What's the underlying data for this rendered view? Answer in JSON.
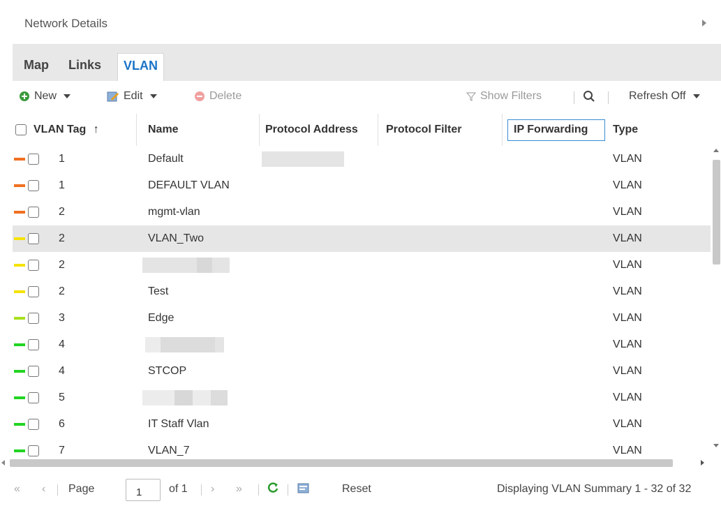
{
  "panel": {
    "title": "Network Details"
  },
  "tabs": [
    {
      "label": "Map",
      "active": false
    },
    {
      "label": "Links",
      "active": false
    },
    {
      "label": "VLAN",
      "active": true
    }
  ],
  "toolbar": {
    "new_label": "New",
    "edit_label": "Edit",
    "delete_label": "Delete",
    "show_filters_label": "Show Filters",
    "refresh_label": "Refresh Off"
  },
  "columns": {
    "vlan_tag": "VLAN Tag",
    "name": "Name",
    "protocol_address": "Protocol Address",
    "protocol_filter": "Protocol Filter",
    "ip_forwarding": "IP Forwarding",
    "type": "Type"
  },
  "sort_indicator": "↑",
  "status_colors": {
    "orange": "#f07020",
    "yellow": "#f5e20a",
    "lime": "#a8e020",
    "green": "#22d422"
  },
  "rows": [
    {
      "tag": "1",
      "name": "Default",
      "type": "VLAN",
      "status": "orange"
    },
    {
      "tag": "1",
      "name": "DEFAULT VLAN",
      "type": "VLAN",
      "status": "orange"
    },
    {
      "tag": "2",
      "name": "mgmt-vlan",
      "type": "VLAN",
      "status": "orange"
    },
    {
      "tag": "2",
      "name": "VLAN_Two",
      "type": "VLAN",
      "status": "yellow"
    },
    {
      "tag": "2",
      "name": "",
      "type": "VLAN",
      "status": "yellow"
    },
    {
      "tag": "2",
      "name": "Test",
      "type": "VLAN",
      "status": "yellow"
    },
    {
      "tag": "3",
      "name": "Edge",
      "type": "VLAN",
      "status": "lime"
    },
    {
      "tag": "4",
      "name": "",
      "type": "VLAN",
      "status": "green"
    },
    {
      "tag": "4",
      "name": "STCOP",
      "type": "VLAN",
      "status": "green"
    },
    {
      "tag": "5",
      "name": "",
      "type": "VLAN",
      "status": "green"
    },
    {
      "tag": "6",
      "name": "IT Staff Vlan",
      "type": "VLAN",
      "status": "green"
    },
    {
      "tag": "7",
      "name": "VLAN_7",
      "type": "VLAN",
      "status": "green"
    }
  ],
  "pager": {
    "page_label": "Page",
    "page_value": "1",
    "of_label": "of 1",
    "reset_label": "Reset",
    "summary": "Displaying VLAN Summary 1 - 32 of 32"
  }
}
